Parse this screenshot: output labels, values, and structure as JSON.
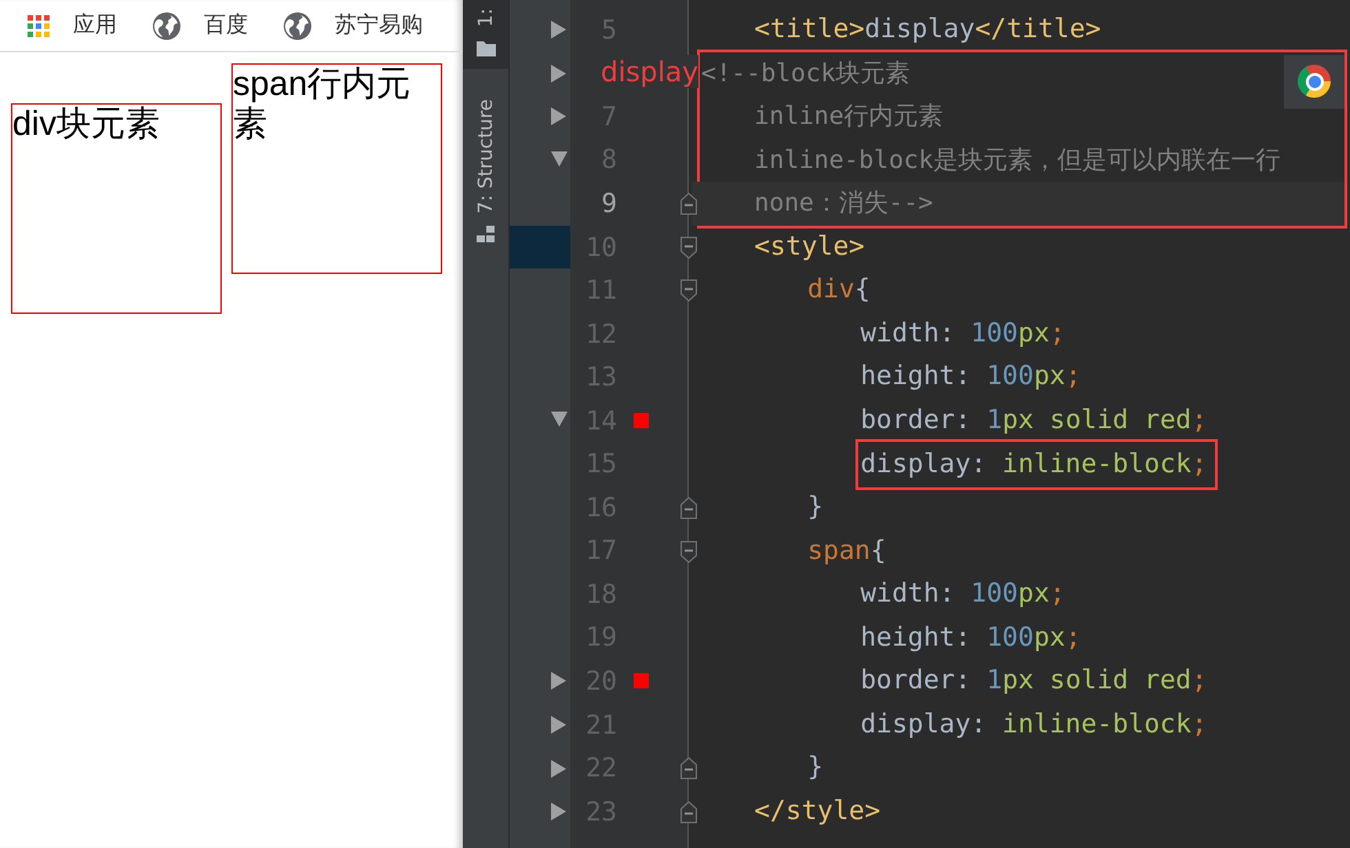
{
  "browser": {
    "bookmarks": [
      {
        "kind": "apps",
        "label": "应用"
      },
      {
        "kind": "site",
        "label": "百度"
      },
      {
        "kind": "site",
        "label": "苏宁易购"
      }
    ],
    "page_boxes": [
      {
        "text": "div块元素"
      },
      {
        "text": "span行内元素"
      }
    ]
  },
  "ide": {
    "tool_tabs": [
      {
        "label": "1:",
        "selected": true
      },
      {
        "label": "7: Structure",
        "selected": false
      }
    ],
    "lines": [
      {
        "number": "5",
        "tree_node": true,
        "tree_expanded": false,
        "current": false,
        "tree_selected": false,
        "boxed": false,
        "kind": "single",
        "tokens": [
          {
            "kind": "tag",
            "text": "<title>"
          },
          {
            "kind": "text",
            "text": "display"
          },
          {
            "kind": "tag",
            "text": "</title>"
          }
        ]
      },
      {
        "note": "display",
        "tree_node": true,
        "tree_expanded": false,
        "current": false,
        "tree_selected": false,
        "boxed": true,
        "kind": "flush",
        "tokens": [
          {
            "kind": "comment",
            "text": "<!--block块元素"
          }
        ]
      },
      {
        "number": "7",
        "tree_node": true,
        "tree_expanded": false,
        "current": false,
        "tree_selected": false,
        "boxed": true,
        "kind": "single",
        "tokens": [
          {
            "kind": "comment",
            "text": "inline行内元素"
          }
        ]
      },
      {
        "number": "8",
        "tree_node": true,
        "tree_expanded": true,
        "current": false,
        "tree_selected": false,
        "boxed": true,
        "kind": "single",
        "tokens": [
          {
            "kind": "comment",
            "text": "inline-block是块元素，但是可以内联在一行"
          }
        ]
      },
      {
        "number": "9",
        "fold_end": true,
        "current": true,
        "tree_selected": false,
        "boxed": true,
        "kind": "single",
        "tokens": [
          {
            "kind": "comment",
            "text": "none：消失-->"
          }
        ]
      },
      {
        "number": "10",
        "fold_start": true,
        "current": false,
        "tree_selected": true,
        "boxed": false,
        "kind": "single",
        "tokens": [
          {
            "kind": "tag",
            "text": "<style>"
          }
        ]
      },
      {
        "number": "11",
        "fold_start": true,
        "current": false,
        "tree_selected": false,
        "boxed": false,
        "kind": "double",
        "tokens": [
          {
            "kind": "selector",
            "text": "div"
          },
          {
            "kind": "brace",
            "text": "{"
          }
        ]
      },
      {
        "number": "12",
        "current": false,
        "tree_selected": false,
        "boxed": false,
        "kind": "triple",
        "tokens": [
          {
            "kind": "prop",
            "text": "width: "
          },
          {
            "kind": "num",
            "text": "100"
          },
          {
            "kind": "unit",
            "text": "px"
          },
          {
            "kind": "punct",
            "text": ";"
          }
        ]
      },
      {
        "number": "13",
        "current": false,
        "tree_selected": false,
        "boxed": false,
        "kind": "triple",
        "tokens": [
          {
            "kind": "prop",
            "text": "height: "
          },
          {
            "kind": "num",
            "text": "100"
          },
          {
            "kind": "unit",
            "text": "px"
          },
          {
            "kind": "punct",
            "text": ";"
          }
        ]
      },
      {
        "number": "14",
        "color": "#ff0000",
        "tree_node": true,
        "tree_expanded": true,
        "current": false,
        "tree_selected": false,
        "boxed": false,
        "kind": "triple",
        "tokens": [
          {
            "kind": "prop",
            "text": "border: "
          },
          {
            "kind": "num",
            "text": "1"
          },
          {
            "kind": "unit",
            "text": "px solid red"
          },
          {
            "kind": "punct",
            "text": ";"
          }
        ]
      },
      {
        "number": "15",
        "current": false,
        "tree_selected": false,
        "boxed": false,
        "kind": "triple",
        "tokens": [
          {
            "kind": "boxed",
            "tokens": [
              {
                "kind": "prop",
                "text": "display: "
              },
              {
                "kind": "value",
                "text": "inline-block"
              },
              {
                "kind": "punct",
                "text": ";"
              }
            ]
          }
        ]
      },
      {
        "number": "16",
        "fold_end": true,
        "current": false,
        "tree_selected": false,
        "boxed": false,
        "kind": "double",
        "tokens": [
          {
            "kind": "brace",
            "text": "}"
          }
        ]
      },
      {
        "number": "17",
        "fold_start": true,
        "current": false,
        "tree_selected": false,
        "boxed": false,
        "kind": "double",
        "tokens": [
          {
            "kind": "selector",
            "text": "span"
          },
          {
            "kind": "brace",
            "text": "{"
          }
        ]
      },
      {
        "number": "18",
        "current": false,
        "tree_selected": false,
        "boxed": false,
        "kind": "triple",
        "tokens": [
          {
            "kind": "prop",
            "text": "width: "
          },
          {
            "kind": "num",
            "text": "100"
          },
          {
            "kind": "unit",
            "text": "px"
          },
          {
            "kind": "punct",
            "text": ";"
          }
        ]
      },
      {
        "number": "19",
        "current": false,
        "tree_selected": false,
        "boxed": false,
        "kind": "triple",
        "tokens": [
          {
            "kind": "prop",
            "text": "height: "
          },
          {
            "kind": "num",
            "text": "100"
          },
          {
            "kind": "unit",
            "text": "px"
          },
          {
            "kind": "punct",
            "text": ";"
          }
        ]
      },
      {
        "number": "20",
        "color": "#ff0000",
        "tree_node": true,
        "tree_expanded": false,
        "current": false,
        "tree_selected": false,
        "boxed": false,
        "kind": "triple",
        "tokens": [
          {
            "kind": "prop",
            "text": "border: "
          },
          {
            "kind": "num",
            "text": "1"
          },
          {
            "kind": "unit",
            "text": "px solid red"
          },
          {
            "kind": "punct",
            "text": ";"
          }
        ]
      },
      {
        "number": "21",
        "tree_node": true,
        "tree_expanded": false,
        "current": false,
        "tree_selected": false,
        "boxed": false,
        "kind": "triple",
        "tokens": [
          {
            "kind": "prop",
            "text": "display: "
          },
          {
            "kind": "value",
            "text": "inline-block"
          },
          {
            "kind": "punct",
            "text": ";"
          }
        ]
      },
      {
        "number": "22",
        "fold_end": true,
        "tree_node": true,
        "tree_expanded": false,
        "current": false,
        "tree_selected": false,
        "boxed": false,
        "kind": "double",
        "tokens": [
          {
            "kind": "brace",
            "text": "}"
          }
        ]
      },
      {
        "number": "23",
        "fold_end": true,
        "tree_node": true,
        "tree_expanded": false,
        "current": false,
        "tree_selected": false,
        "boxed": false,
        "kind": "single",
        "tokens": [
          {
            "kind": "tag",
            "text": "</style>"
          }
        ]
      }
    ]
  }
}
